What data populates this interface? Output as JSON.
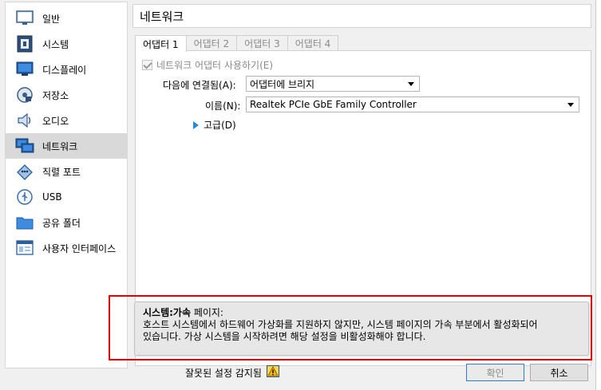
{
  "sidebar": {
    "items": [
      {
        "label": "일반",
        "icon": "general-icon"
      },
      {
        "label": "시스템",
        "icon": "system-icon"
      },
      {
        "label": "디스플레이",
        "icon": "display-icon"
      },
      {
        "label": "저장소",
        "icon": "storage-icon"
      },
      {
        "label": "오디오",
        "icon": "audio-icon"
      },
      {
        "label": "네트워크",
        "icon": "network-icon",
        "selected": true
      },
      {
        "label": "직렬 포트",
        "icon": "serial-port-icon"
      },
      {
        "label": "USB",
        "icon": "usb-icon"
      },
      {
        "label": "공유 폴더",
        "icon": "shared-folder-icon"
      },
      {
        "label": "사용자 인터페이스",
        "icon": "user-interface-icon"
      }
    ]
  },
  "page_title": "네트워크",
  "tabs": [
    {
      "label": "어댑터 1",
      "active": true
    },
    {
      "label": "어댑터 2",
      "active": false
    },
    {
      "label": "어댑터 3",
      "active": false
    },
    {
      "label": "어댑터 4",
      "active": false
    }
  ],
  "adapter": {
    "enable_label": "네트워크 어댑터 사용하기(E)",
    "enabled": true,
    "attached_label": "다음에 연결됨(A):",
    "attached_value": "어댑터에 브리지",
    "name_label": "이름(N):",
    "name_value": "Realtek PCIe GbE Family Controller",
    "advanced_label": "고급(D)"
  },
  "warning": {
    "title_bold": "시스템:가속",
    "title_rest": " 페이지:",
    "line1": "호스트 시스템에서 하드웨어 가상화를 지원하지 않지만, 시스템 페이지의 가속 부분에서 활성화되어",
    "line2": "있습니다. 가상 시스템을 시작하려면 해당 설정을 비활성화해야 합니다."
  },
  "status": {
    "text": "잘못된 설정 감지됨"
  },
  "buttons": {
    "ok": "확인",
    "cancel": "취소"
  },
  "colors": {
    "highlight_red": "#e00000",
    "selected_bg": "#d9d9d9",
    "accent_blue": "#2a8ad4"
  }
}
